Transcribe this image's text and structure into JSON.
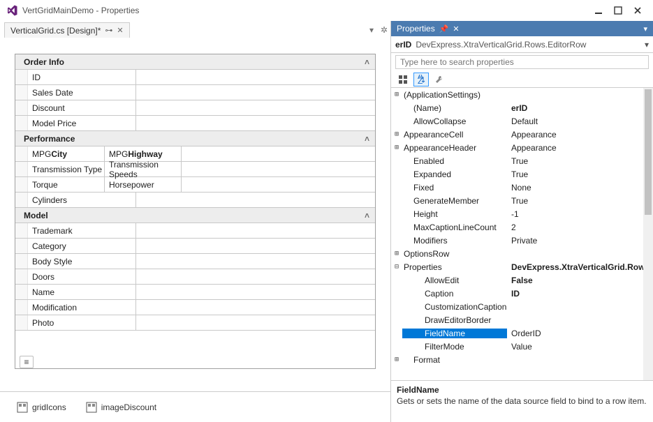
{
  "window": {
    "title": "VertGridMainDemo - Properties"
  },
  "tab": {
    "label": "VerticalGrid.cs [Design]*"
  },
  "grid": {
    "cat1": "Order Info",
    "c1r1": "ID",
    "c1r2": "Sales Date",
    "c1r3": "Discount",
    "c1r4": "Model Price",
    "cat2": "Performance",
    "c2r1a_pre": "MPG ",
    "c2r1a_b": "City",
    "c2r1b_pre": "MPG ",
    "c2r1b_b": "Highway",
    "c2r2a": "Transmission Type",
    "c2r2b": "Transmission Speeds",
    "c2r3a": "Torque",
    "c2r3b": "Horsepower",
    "c2r4": "Cylinders",
    "cat3": "Model",
    "c3r1": "Trademark",
    "c3r2": "Category",
    "c3r3": "Body Style",
    "c3r4": "Doors",
    "c3r5": "Name",
    "c3r6": "Modification",
    "c3r7": "Photo"
  },
  "tray": {
    "item1": "gridIcons",
    "item2": "imageDiscount"
  },
  "props": {
    "title": "Properties",
    "selName": "erID",
    "selType": "DevExpress.XtraVerticalGrid.Rows.EditorRow",
    "searchPlaceholder": "Type here to search properties",
    "rows": {
      "appSettings": "(ApplicationSettings)",
      "name_l": "(Name)",
      "name_v": "erID",
      "allowCollapse_l": "AllowCollapse",
      "allowCollapse_v": "Default",
      "appCell_l": "AppearanceCell",
      "appCell_v": "Appearance",
      "appHdr_l": "AppearanceHeader",
      "appHdr_v": "Appearance",
      "enabled_l": "Enabled",
      "enabled_v": "True",
      "expanded_l": "Expanded",
      "expanded_v": "True",
      "fixed_l": "Fixed",
      "fixed_v": "None",
      "genMember_l": "GenerateMember",
      "genMember_v": "True",
      "height_l": "Height",
      "height_v": "-1",
      "maxCap_l": "MaxCaptionLineCount",
      "maxCap_v": "2",
      "modifiers_l": "Modifiers",
      "modifiers_v": "Private",
      "optRow_l": "OptionsRow",
      "properties_l": "Properties",
      "properties_v": "DevExpress.XtraVerticalGrid.Row",
      "allowEdit_l": "AllowEdit",
      "allowEdit_v": "False",
      "caption_l": "Caption",
      "caption_v": "ID",
      "custCap_l": "CustomizationCaption",
      "drawBorder_l": "DrawEditorBorder",
      "fieldName_l": "FieldName",
      "fieldName_v": "OrderID",
      "filterMode_l": "FilterMode",
      "filterMode_v": "Value",
      "format_l": "Format"
    },
    "desc": {
      "name": "FieldName",
      "text": "Gets or sets the name of the data source field to bind to a row item."
    }
  }
}
